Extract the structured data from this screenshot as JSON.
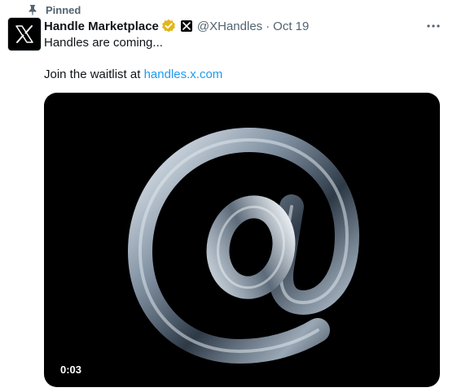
{
  "pinned": {
    "label": "Pinned",
    "icon": "pin-icon"
  },
  "author": {
    "display_name": "Handle Marketplace",
    "handle": "@XHandles",
    "separator": "·",
    "date": "Oct 19",
    "avatar_icon": "x-logo-icon",
    "verified_icon": "gold-verified-badge-icon",
    "affiliate_icon": "x-affiliate-badge-icon",
    "verified_color": "#e2b719"
  },
  "tweet": {
    "line1": "Handles are coming...",
    "line2_prefix": "Join the waitlist at ",
    "link_text": "handles.x.com",
    "link_color": "#1d9bf0"
  },
  "media": {
    "type": "video",
    "timestamp": "0:03",
    "subject_icon": "at-sign-icon"
  },
  "menu": {
    "icon": "more-options-icon"
  }
}
